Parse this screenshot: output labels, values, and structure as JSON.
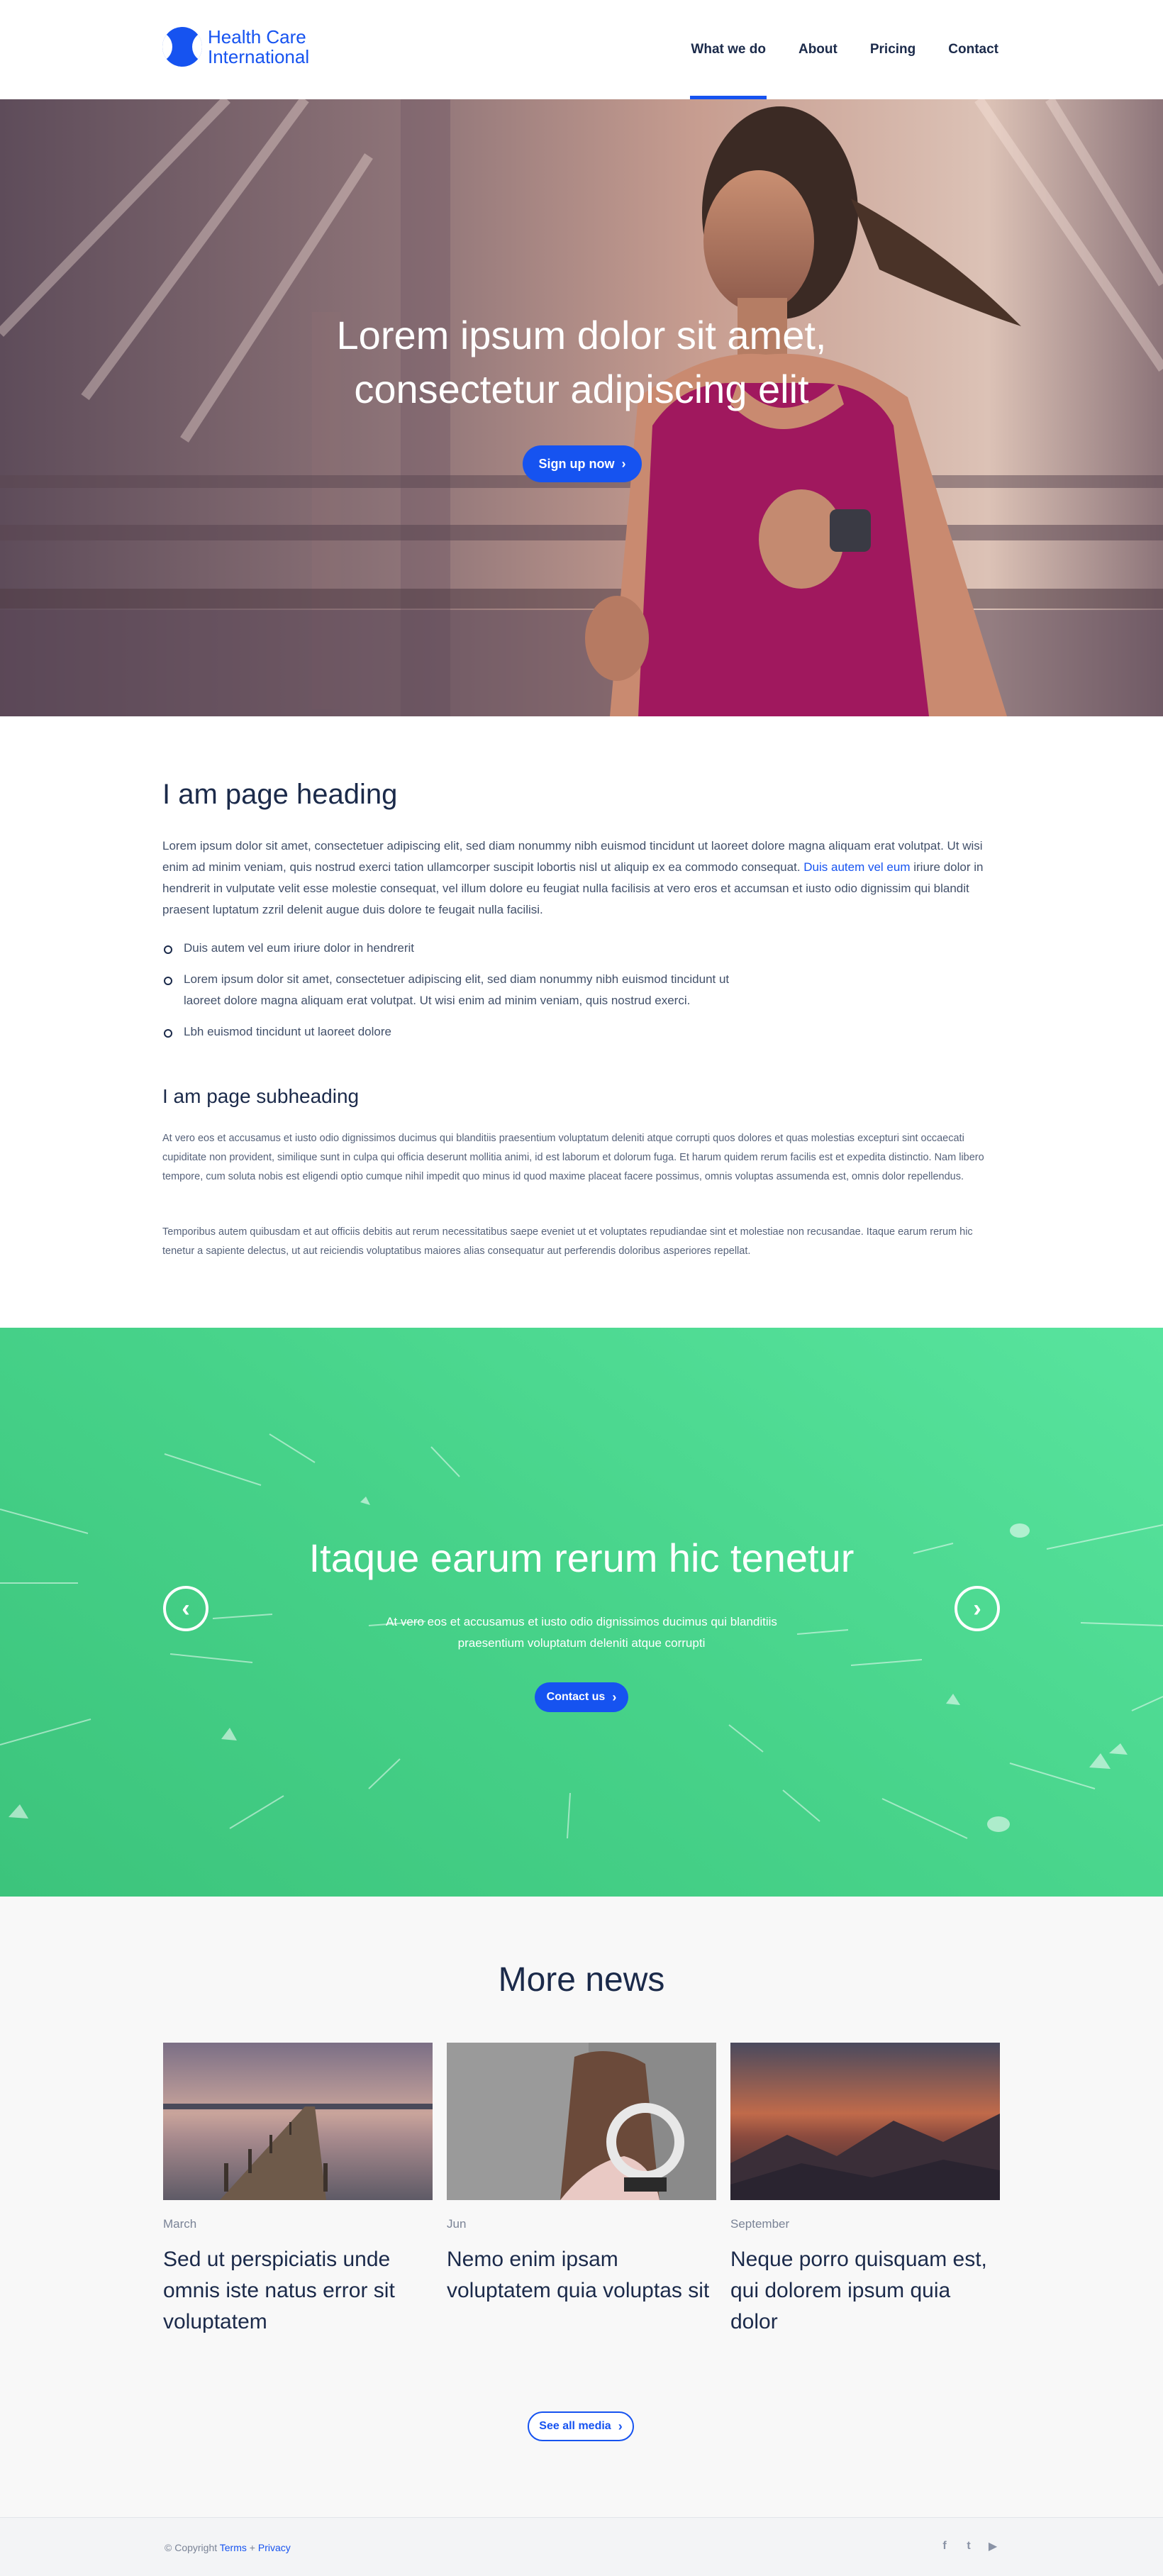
{
  "brand": {
    "line1": "Health Care",
    "line2": "International",
    "color": "#1653f0"
  },
  "nav": {
    "items": [
      "What we do",
      "About",
      "Pricing",
      "Contact"
    ],
    "active": "What we do"
  },
  "hero": {
    "title_line1": "Lorem ipsum dolor sit amet,",
    "title_line2": "consectetur adipiscing elit",
    "button": "Sign up now"
  },
  "content": {
    "heading": "I am page heading",
    "para1_a": "Lorem ipsum dolor sit amet, consectetuer adipiscing elit, sed diam nonummy nibh euismod tincidunt ut laoreet dolore magna aliquam erat volutpat. Ut wisi enim ad minim veniam, quis nostrud exerci tation ullamcorper suscipit lobortis nisl ut aliquip ex ea commodo consequat. ",
    "para1_link": "Duis autem vel eum",
    "para1_b": " iriure dolor in hendrerit in vulputate velit esse molestie consequat, vel illum dolore eu feugiat nulla facilisis at vero eros et accumsan et iusto odio dignissim qui blandit praesent luptatum zzril delenit augue duis dolore te feugait nulla facilisi.",
    "bullets": [
      "Duis autem vel eum iriure dolor in hendrerit",
      "Lorem ipsum dolor sit amet, consectetuer adipiscing elit, sed diam nonummy nibh euismod tincidunt ut laoreet dolore magna aliquam erat volutpat. Ut wisi enim ad minim veniam, quis nostrud exerci.",
      "Lbh euismod tincidunt ut laoreet dolore"
    ],
    "subheading": "I am page subheading",
    "para2": "At vero eos et accusamus et iusto odio dignissimos ducimus qui blanditiis praesentium voluptatum deleniti atque corrupti quos dolores et quas molestias excepturi sint occaecati cupiditate non provident, similique sunt in culpa qui officia deserunt mollitia animi, id est laborum et dolorum fuga. Et harum quidem rerum facilis est et expedita distinctio. Nam libero tempore, cum soluta nobis est eligendi optio cumque nihil impedit quo minus id quod maxime placeat facere possimus, omnis voluptas assumenda est, omnis dolor repellendus.",
    "para3": "Temporibus autem quibusdam et aut officiis debitis aut rerum necessitatibus saepe eveniet ut et voluptates repudiandae sint et molestiae non recusandae. Itaque earum rerum hic tenetur a sapiente delectus, ut aut reiciendis voluptatibus maiores alias consequatur aut perferendis doloribus asperiores repellat."
  },
  "band": {
    "title": "Itaque earum rerum hic tenetur",
    "subtitle": "At vero eos et accusamus et iusto odio dignissimos ducimus qui blanditiis praesentium voluptatum deleniti atque corrupti",
    "button": "Contact us",
    "color": "#47d38a"
  },
  "news": {
    "title": "More news",
    "cards": [
      {
        "month": "March",
        "title": "Sed ut perspiciatis unde omnis iste natus error sit voluptatem",
        "image": "pier-at-sunset"
      },
      {
        "month": "Jun",
        "title": "Nemo enim ipsam voluptatem quia voluptas sit",
        "image": "woman-with-headphones"
      },
      {
        "month": "September",
        "title": "Neque porro quisquam est, qui dolorem ipsum quia dolor",
        "image": "mountain-sunset"
      }
    ],
    "button": "See all media"
  },
  "footer": {
    "copyright": "© Copyright",
    "terms": "Terms",
    "sep": "+",
    "privacy": "Privacy",
    "social": [
      "facebook-icon",
      "twitter-icon",
      "youtube-icon"
    ]
  }
}
